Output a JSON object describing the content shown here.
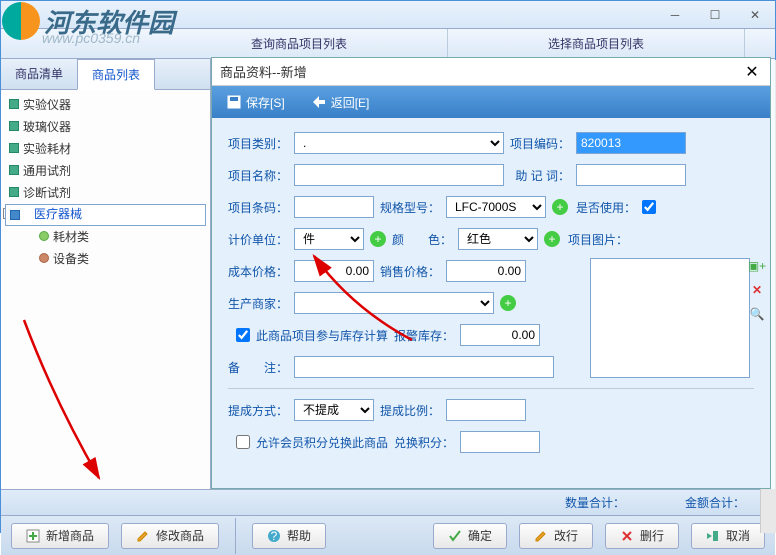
{
  "watermark": {
    "text": "河东软件园",
    "url": "www.pc0359.cn"
  },
  "window": {
    "title": ""
  },
  "headerTabs": {
    "query": "查询商品项目列表",
    "select": "选择商品项目列表"
  },
  "leftTabs": {
    "list": "商品清单",
    "items": "商品列表"
  },
  "tree": {
    "n0": "实验仪器",
    "n1": "玻璃仪器",
    "n2": "实验耗材",
    "n3": "通用试剂",
    "n4": "诊断试剂",
    "n5": "医疗器械",
    "n5a": "耗材类",
    "n5b": "设备类"
  },
  "dialog": {
    "title": "商品资料--新增",
    "save": "保存[S]",
    "back": "返回[E]",
    "lbl_category": "项目类别：",
    "lbl_code": "项目编码：",
    "val_code": "820013",
    "lbl_name": "项目名称：",
    "lbl_mnemonic": "助 记 词：",
    "lbl_barcode": "项目条码：",
    "lbl_spec": "规格型号：",
    "val_spec": "LFC-7000S",
    "lbl_enabled": "是否使用：",
    "lbl_unit": "计价单位：",
    "val_unit": "件",
    "lbl_color": "颜　　色：",
    "val_color": "红色",
    "lbl_image": "项目图片：",
    "lbl_cost": "成本价格：",
    "val_cost": "0.00",
    "lbl_price": "销售价格：",
    "val_price": "0.00",
    "lbl_mfr": "生产商家：",
    "chk_stock": "此商品项目参与库存计算",
    "lbl_alarm": "报警库存：",
    "val_alarm": "0.00",
    "lbl_remark": "备　　注：",
    "lbl_commission": "提成方式：",
    "val_commission": "不提成",
    "lbl_ratio": "提成比例：",
    "chk_points": "允许会员积分兑换此商品",
    "lbl_points": "兑换积分："
  },
  "footerInfo": {
    "qty": "数量合计：",
    "amount": "金额合计："
  },
  "buttons": {
    "add": "新增商品",
    "edit": "修改商品",
    "help": "帮助",
    "ok": "确定",
    "modify": "改行",
    "delete": "删行",
    "cancel": "取消"
  }
}
